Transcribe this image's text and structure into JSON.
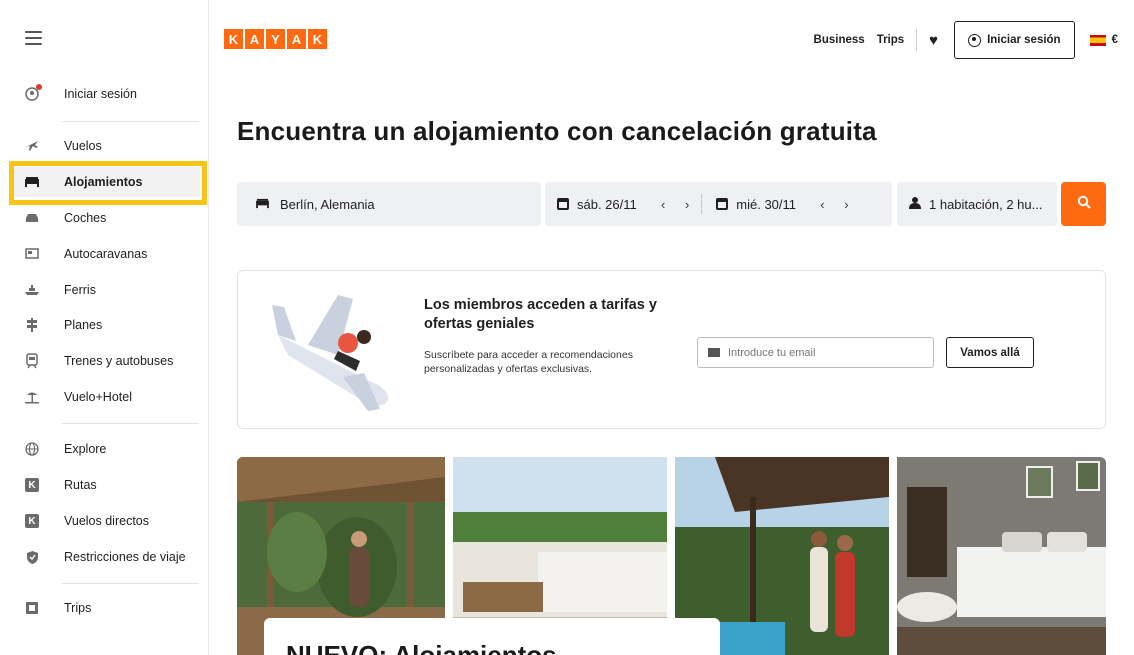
{
  "header": {
    "logo_letters": [
      "K",
      "A",
      "Y",
      "A",
      "K"
    ],
    "business_label": "Business",
    "trips_label": "Trips",
    "login_label": "Iniciar sesión",
    "currency": "€",
    "brand_color": "#ff690f"
  },
  "sidebar": {
    "items": [
      {
        "label": "Iniciar sesión",
        "icon": "user-icon"
      },
      {
        "label": "Vuelos",
        "icon": "plane-icon"
      },
      {
        "label": "Alojamientos",
        "icon": "bed-icon"
      },
      {
        "label": "Coches",
        "icon": "car-icon"
      },
      {
        "label": "Autocaravanas",
        "icon": "rv-icon"
      },
      {
        "label": "Ferris",
        "icon": "ferry-icon"
      },
      {
        "label": "Planes",
        "icon": "signpost-icon"
      },
      {
        "label": "Trenes y autobuses",
        "icon": "train-icon"
      },
      {
        "label": "Vuelo+Hotel",
        "icon": "beach-icon"
      },
      {
        "label": "Explore",
        "icon": "globe-icon"
      },
      {
        "label": "Rutas",
        "icon": "kayak-k-icon"
      },
      {
        "label": "Vuelos directos",
        "icon": "kayak-k-icon"
      },
      {
        "label": "Restricciones de viaje",
        "icon": "shield-icon"
      },
      {
        "label": "Trips",
        "icon": "suitcase-icon"
      }
    ]
  },
  "main": {
    "title": "Encuentra un alojamiento con cancelación gratuita"
  },
  "search": {
    "destination": "Berlín, Alemania",
    "checkin": "sáb. 26/11",
    "checkout": "mié. 30/11",
    "guests": "1 habitación, 2 hu..."
  },
  "promo": {
    "title": "Los miembros acceden a tarifas y ofertas geniales",
    "text": "Suscríbete para acceder a recomendaciones personalizadas y ofertas exclusivas.",
    "email_placeholder": "Introduce tu email",
    "button_label": "Vamos allá"
  },
  "feature": {
    "title": "NUEVO: Alojamientos"
  }
}
